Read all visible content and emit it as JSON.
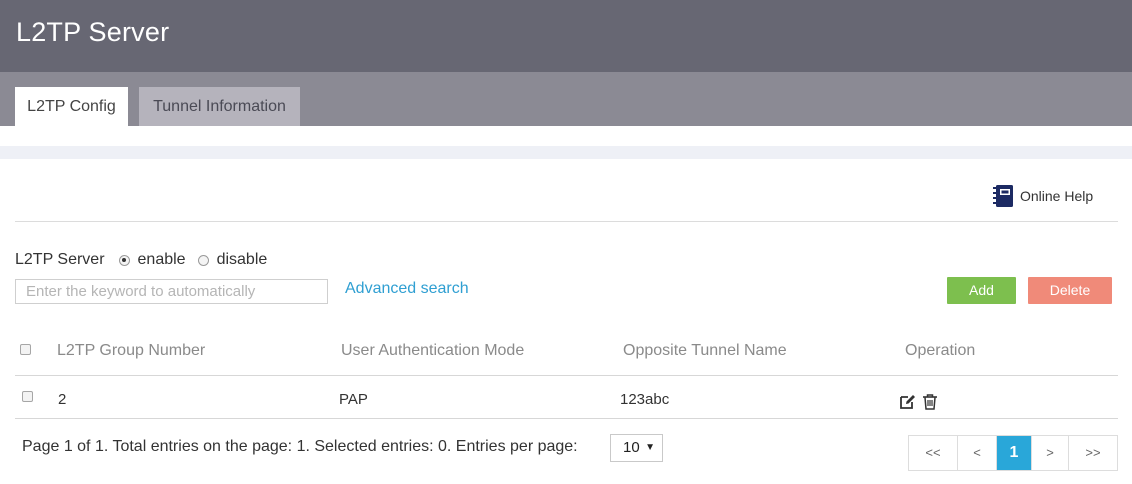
{
  "header": {
    "title": "L2TP Server"
  },
  "tabs": [
    {
      "label": "L2TP Config"
    },
    {
      "label": "Tunnel Information"
    }
  ],
  "help": {
    "label": "Online Help",
    "icon": "notebook-icon"
  },
  "server": {
    "label": "L2TP Server",
    "options": [
      {
        "label": "enable",
        "checked": true
      },
      {
        "label": "disable",
        "checked": false
      }
    ]
  },
  "search": {
    "placeholder": "Enter the keyword to automatically",
    "value": ""
  },
  "advanced_search": "Advanced search",
  "buttons": {
    "add": "Add",
    "delete": "Delete"
  },
  "colors": {
    "add": "#7dbf4e",
    "delete": "#f08a79",
    "link": "#2f9fd2",
    "accent": "#29a7d9"
  },
  "table": {
    "columns": [
      "L2TP Group Number",
      "User Authentication Mode",
      "Opposite Tunnel Name",
      "Operation"
    ],
    "rows": [
      {
        "group": "2",
        "auth": "PAP",
        "tunnel": "123abc"
      }
    ]
  },
  "footer": {
    "info": "Page 1 of 1. Total entries on the page: 1. Selected entries: 0. Entries per page:",
    "per_page": "10",
    "pages": [
      "<<",
      "<",
      "1",
      ">",
      ">>"
    ],
    "current_page": "1"
  }
}
